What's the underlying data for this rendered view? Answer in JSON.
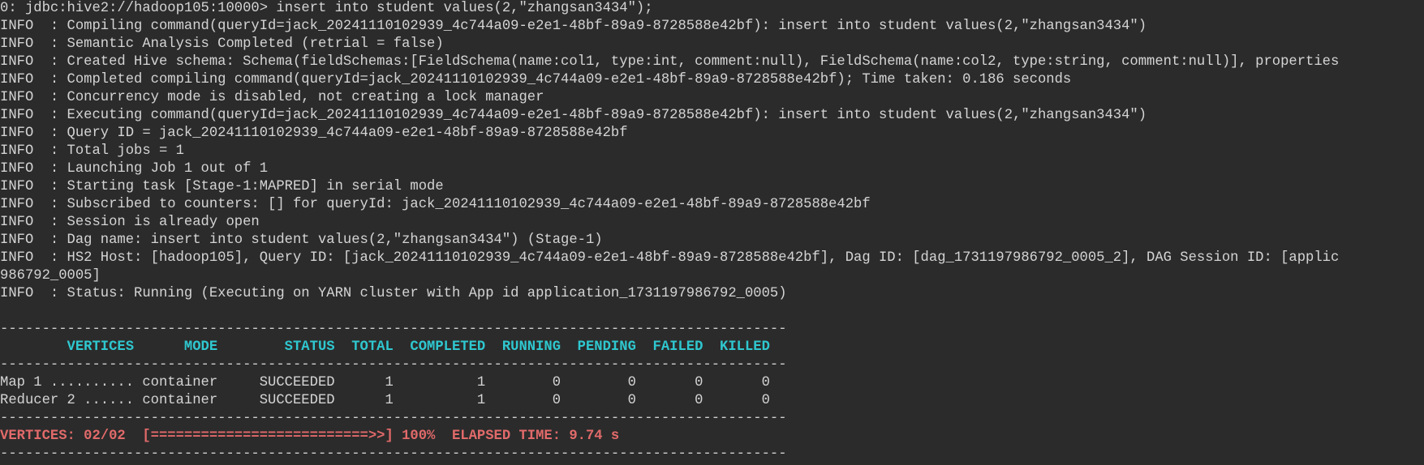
{
  "terminal": {
    "prompt": "0: jdbc:hive2://hadoop105:10000> ",
    "command": "insert into student values(2,\"zhangsan3434\");",
    "log_lines": [
      "INFO  : Compiling command(queryId=jack_20241110102939_4c744a09-e2e1-48bf-89a9-8728588e42bf): insert into student values(2,\"zhangsan3434\")",
      "INFO  : Semantic Analysis Completed (retrial = false)",
      "INFO  : Created Hive schema: Schema(fieldSchemas:[FieldSchema(name:col1, type:int, comment:null), FieldSchema(name:col2, type:string, comment:null)], properties",
      "INFO  : Completed compiling command(queryId=jack_20241110102939_4c744a09-e2e1-48bf-89a9-8728588e42bf); Time taken: 0.186 seconds",
      "INFO  : Concurrency mode is disabled, not creating a lock manager",
      "INFO  : Executing command(queryId=jack_20241110102939_4c744a09-e2e1-48bf-89a9-8728588e42bf): insert into student values(2,\"zhangsan3434\")",
      "INFO  : Query ID = jack_20241110102939_4c744a09-e2e1-48bf-89a9-8728588e42bf",
      "INFO  : Total jobs = 1",
      "INFO  : Launching Job 1 out of 1",
      "INFO  : Starting task [Stage-1:MAPRED] in serial mode",
      "INFO  : Subscribed to counters: [] for queryId: jack_20241110102939_4c744a09-e2e1-48bf-89a9-8728588e42bf",
      "INFO  : Session is already open",
      "INFO  : Dag name: insert into student values(2,\"zhangsan3434\") (Stage-1)",
      "INFO  : HS2 Host: [hadoop105], Query ID: [jack_20241110102939_4c744a09-e2e1-48bf-89a9-8728588e42bf], Dag ID: [dag_1731197986792_0005_2], DAG Session ID: [applic",
      "986792_0005]",
      "INFO  : Status: Running (Executing on YARN cluster with App id application_1731197986792_0005)"
    ],
    "blank": "",
    "separator": "----------------------------------------------------------------------------------------------",
    "table_header": "        VERTICES      MODE        STATUS  TOTAL  COMPLETED  RUNNING  PENDING  FAILED  KILLED",
    "rows": [
      "Map 1 .......... container     SUCCEEDED      1          1        0        0       0       0",
      "Reducer 2 ...... container     SUCCEEDED      1          1        0        0       0       0"
    ],
    "summary": "VERTICES: 02/02  [==========================>>] 100%  ELAPSED TIME: 9.74 s",
    "colors": {
      "background": "#2b2b2b",
      "text": "#d4d4d4",
      "header": "#2fc7cf",
      "summary": "#e26a6a"
    }
  }
}
